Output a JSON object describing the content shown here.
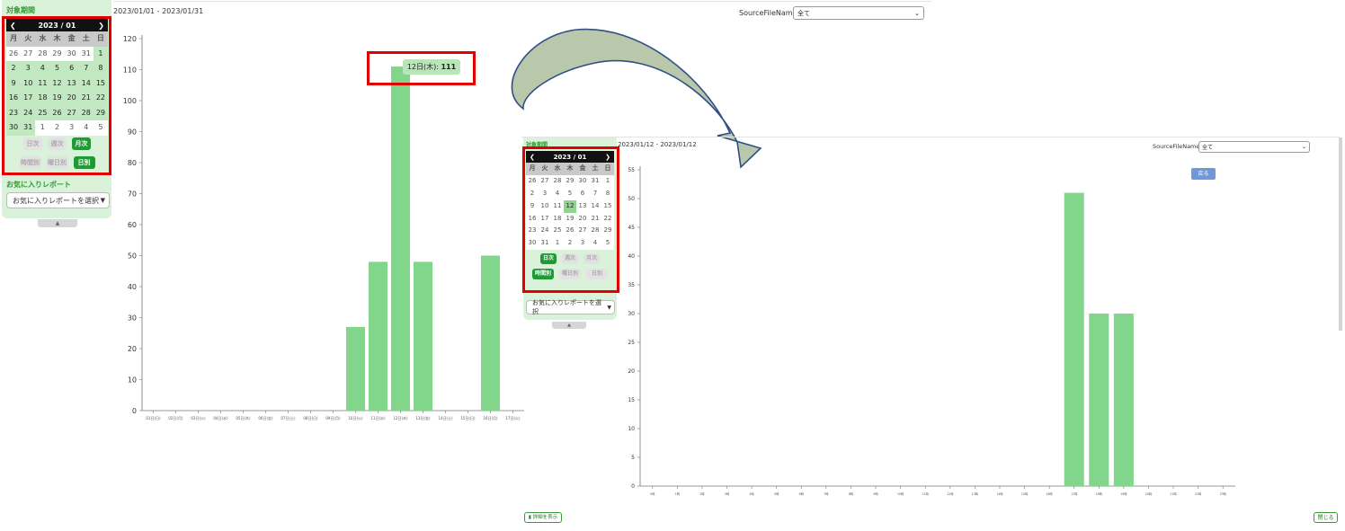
{
  "left": {
    "period_title": "対象期間",
    "date_range": "2023/01/01 - 2023/01/31",
    "calendar": {
      "month_label": "2023 / 01",
      "weekdays": [
        "月",
        "火",
        "水",
        "木",
        "金",
        "土",
        "日"
      ],
      "days": [
        {
          "n": "26",
          "in": false
        },
        {
          "n": "27",
          "in": false
        },
        {
          "n": "28",
          "in": false
        },
        {
          "n": "29",
          "in": false
        },
        {
          "n": "30",
          "in": false
        },
        {
          "n": "31",
          "in": false
        },
        {
          "n": "1",
          "in": true
        },
        {
          "n": "2",
          "in": true
        },
        {
          "n": "3",
          "in": true
        },
        {
          "n": "4",
          "in": true
        },
        {
          "n": "5",
          "in": true
        },
        {
          "n": "6",
          "in": true
        },
        {
          "n": "7",
          "in": true
        },
        {
          "n": "8",
          "in": true
        },
        {
          "n": "9",
          "in": true
        },
        {
          "n": "10",
          "in": true
        },
        {
          "n": "11",
          "in": true
        },
        {
          "n": "12",
          "in": true
        },
        {
          "n": "13",
          "in": true
        },
        {
          "n": "14",
          "in": true
        },
        {
          "n": "15",
          "in": true
        },
        {
          "n": "16",
          "in": true
        },
        {
          "n": "17",
          "in": true
        },
        {
          "n": "18",
          "in": true
        },
        {
          "n": "19",
          "in": true
        },
        {
          "n": "20",
          "in": true
        },
        {
          "n": "21",
          "in": true
        },
        {
          "n": "22",
          "in": true
        },
        {
          "n": "23",
          "in": true
        },
        {
          "n": "24",
          "in": true
        },
        {
          "n": "25",
          "in": true
        },
        {
          "n": "26",
          "in": true
        },
        {
          "n": "27",
          "in": true
        },
        {
          "n": "28",
          "in": true
        },
        {
          "n": "29",
          "in": true
        },
        {
          "n": "30",
          "in": true
        },
        {
          "n": "31",
          "in": true
        },
        {
          "n": "1",
          "in": false
        },
        {
          "n": "2",
          "in": false
        },
        {
          "n": "3",
          "in": false
        },
        {
          "n": "4",
          "in": false
        },
        {
          "n": "5",
          "in": false
        }
      ]
    },
    "period_buttons": [
      {
        "label": "日次",
        "active": false
      },
      {
        "label": "週次",
        "active": false
      },
      {
        "label": "月次",
        "active": true
      }
    ],
    "unit_buttons": [
      {
        "label": "時間別",
        "active": false
      },
      {
        "label": "曜日別",
        "active": false
      },
      {
        "label": "日別",
        "active": true
      }
    ],
    "favorite_title": "お気に入りレポート",
    "favorite_placeholder": "お気に入りレポートを選択",
    "collapse_glyph": "▲",
    "source_label": "SourceFileName",
    "source_value": "全て",
    "detail_button": "詳細を表示",
    "tooltip_label": "12日(木):",
    "tooltip_value": "111"
  },
  "right": {
    "period_title": "対象期間",
    "date_range": "2023/01/12 - 2023/01/12",
    "calendar": {
      "month_label": "2023 / 01",
      "weekdays": [
        "月",
        "火",
        "水",
        "木",
        "金",
        "土",
        "日"
      ],
      "days": [
        {
          "n": "26",
          "in": false
        },
        {
          "n": "27",
          "in": false
        },
        {
          "n": "28",
          "in": false
        },
        {
          "n": "29",
          "in": false
        },
        {
          "n": "30",
          "in": false
        },
        {
          "n": "31",
          "in": false
        },
        {
          "n": "1",
          "in": false
        },
        {
          "n": "2",
          "in": false
        },
        {
          "n": "3",
          "in": false
        },
        {
          "n": "4",
          "in": false
        },
        {
          "n": "5",
          "in": false
        },
        {
          "n": "6",
          "in": false
        },
        {
          "n": "7",
          "in": false
        },
        {
          "n": "8",
          "in": false
        },
        {
          "n": "9",
          "in": false
        },
        {
          "n": "10",
          "in": false
        },
        {
          "n": "11",
          "in": false
        },
        {
          "n": "12",
          "in": true
        },
        {
          "n": "13",
          "in": false
        },
        {
          "n": "14",
          "in": false
        },
        {
          "n": "15",
          "in": false
        },
        {
          "n": "16",
          "in": false
        },
        {
          "n": "17",
          "in": false
        },
        {
          "n": "18",
          "in": false
        },
        {
          "n": "19",
          "in": false
        },
        {
          "n": "20",
          "in": false
        },
        {
          "n": "21",
          "in": false
        },
        {
          "n": "22",
          "in": false
        },
        {
          "n": "23",
          "in": false
        },
        {
          "n": "24",
          "in": false
        },
        {
          "n": "25",
          "in": false
        },
        {
          "n": "26",
          "in": false
        },
        {
          "n": "27",
          "in": false
        },
        {
          "n": "28",
          "in": false
        },
        {
          "n": "29",
          "in": false
        },
        {
          "n": "30",
          "in": false
        },
        {
          "n": "31",
          "in": false
        },
        {
          "n": "1",
          "in": false
        },
        {
          "n": "2",
          "in": false
        },
        {
          "n": "3",
          "in": false
        },
        {
          "n": "4",
          "in": false
        },
        {
          "n": "5",
          "in": false
        }
      ]
    },
    "period_buttons": [
      {
        "label": "日次",
        "active": true
      },
      {
        "label": "週次",
        "active": false
      },
      {
        "label": "月次",
        "active": false
      }
    ],
    "unit_buttons": [
      {
        "label": "時間別",
        "active": true
      },
      {
        "label": "曜日別",
        "active": false
      },
      {
        "label": "日別",
        "active": false
      }
    ],
    "favorite_placeholder": "お気に入りレポートを選択",
    "collapse_glyph": "▲",
    "source_label": "SourceFileName",
    "source_value": "全て",
    "back_button": "戻る",
    "close_button": "閉じる"
  },
  "chart_data": [
    {
      "type": "bar",
      "categories": [
        "01日(日)",
        "02日(月)",
        "03日(火)",
        "04日(水)",
        "05日(木)",
        "06日(金)",
        "07日(土)",
        "08日(日)",
        "09日(月)",
        "10日(火)",
        "11日(水)",
        "12日(木)",
        "13日(金)",
        "14日(土)",
        "15日(日)",
        "16日(月)",
        "17日(火)"
      ],
      "values": [
        0,
        0,
        0,
        0,
        0,
        0,
        0,
        0,
        0,
        27,
        48,
        111,
        48,
        0,
        0,
        50,
        0
      ],
      "ylim": [
        0,
        120
      ],
      "yticks": [
        0,
        10,
        20,
        30,
        40,
        50,
        60,
        70,
        80,
        90,
        100,
        110,
        120
      ],
      "color": "#82d68c"
    },
    {
      "type": "bar",
      "categories": [
        "0時",
        "1時",
        "2時",
        "3時",
        "4時",
        "5時",
        "6時",
        "7時",
        "8時",
        "9時",
        "10時",
        "11時",
        "12時",
        "13時",
        "14時",
        "15時",
        "16時",
        "17時",
        "18時",
        "19時",
        "20時",
        "21時",
        "22時",
        "23時"
      ],
      "values": [
        0,
        0,
        0,
        0,
        0,
        0,
        0,
        0,
        0,
        0,
        0,
        0,
        0,
        0,
        0,
        0,
        0,
        51,
        30,
        30,
        0,
        0,
        0,
        0
      ],
      "ylim": [
        0,
        55
      ],
      "yticks": [
        0,
        5,
        10,
        15,
        20,
        25,
        30,
        35,
        40,
        45,
        50,
        55
      ],
      "color": "#82d68c"
    }
  ],
  "colors": {
    "accent": "#1f9b34",
    "highlight": "#e00000",
    "bar": "#82d68c",
    "arrow_fill": "#b5c5a8"
  }
}
